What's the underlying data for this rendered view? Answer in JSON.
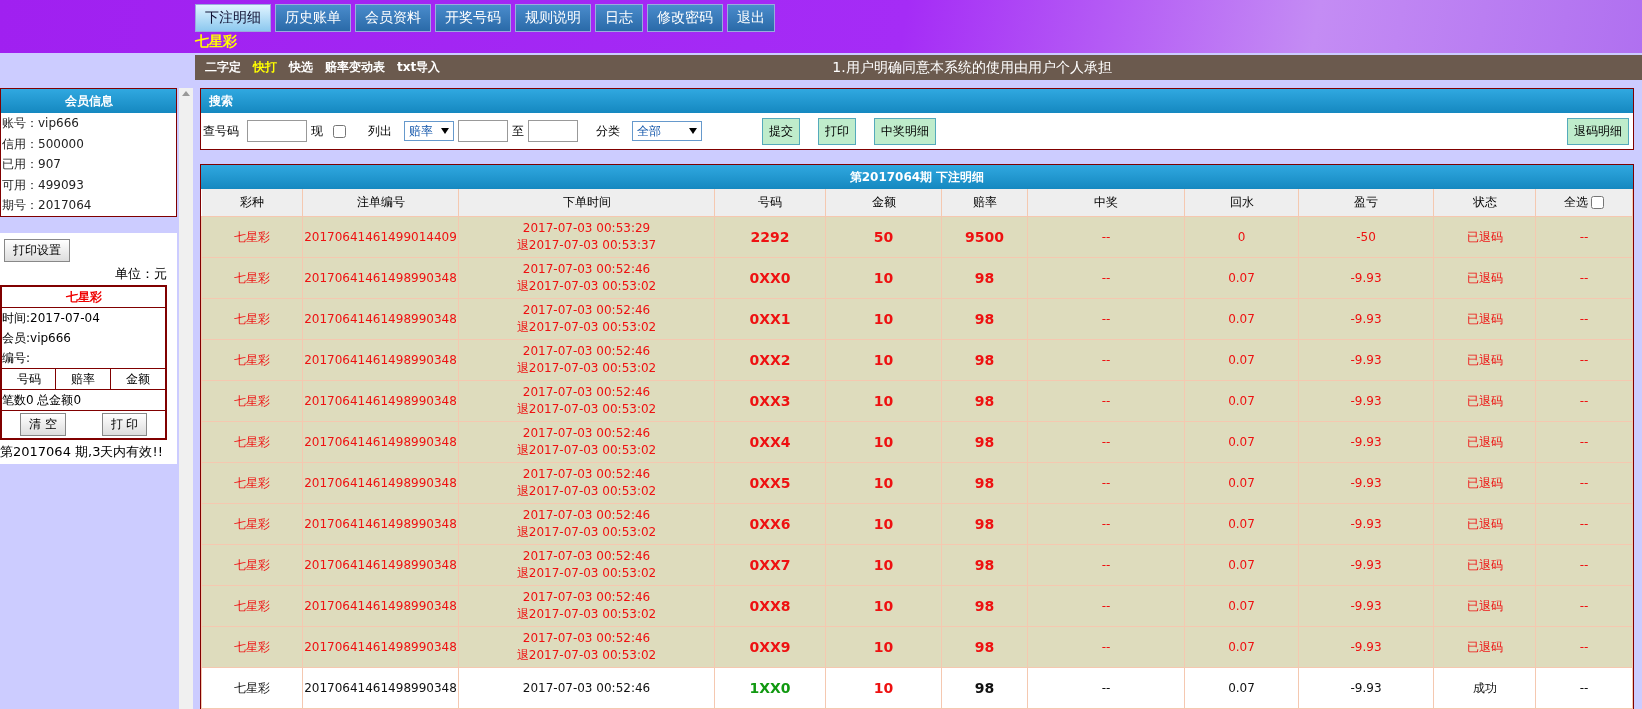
{
  "tabs": [
    {
      "label": "下注明细",
      "selected": true
    },
    {
      "label": "历史账单",
      "selected": false
    },
    {
      "label": "会员资料",
      "selected": false
    },
    {
      "label": "开奖号码",
      "selected": false
    },
    {
      "label": "规则说明",
      "selected": false
    },
    {
      "label": "日志",
      "selected": false
    },
    {
      "label": "修改密码",
      "selected": false
    },
    {
      "label": "退出",
      "selected": false
    }
  ],
  "game_title": "七星彩",
  "subnav": [
    {
      "label": "二字定",
      "selected": false
    },
    {
      "label": "快打",
      "selected": true
    },
    {
      "label": "快选",
      "selected": false
    },
    {
      "label": "赔率变动表",
      "selected": false
    },
    {
      "label": "txt导入",
      "selected": false
    }
  ],
  "notice": "1.用户明确同意本系统的使用由用户个人承担",
  "member_info": {
    "title": "会员信息",
    "fields": [
      "账号：vip666",
      "信用：500000",
      "已用：907",
      "可用：499093",
      "期号：2017064"
    ]
  },
  "print_settings_button": "打印设置",
  "unit_label": "单位：元",
  "ticket": {
    "title": "七星彩",
    "fields": [
      "时间:2017-07-04",
      "会员:vip666",
      "编号:"
    ],
    "columns": [
      "号码",
      "赔率",
      "金额"
    ],
    "summary": "笔数0 总金额0",
    "buttons": [
      "清 空",
      "打 印"
    ]
  },
  "validity_note": "第2017064 期,3天内有效!!",
  "search": {
    "title": "搜索",
    "number_label": "查号码",
    "show_label": "现",
    "show_checked": false,
    "list_label": "列出",
    "list_select": "赔率",
    "range_label": "至",
    "category_label": "分类",
    "category_select": "全部",
    "buttons": [
      "提交",
      "打印",
      "中奖明细"
    ],
    "right_button": "退码明细"
  },
  "bets": {
    "title": "第2017064期 下注明细",
    "columns": [
      "彩种",
      "注单编号",
      "下单时间",
      "号码",
      "金额",
      "赔率",
      "中奖",
      "回水",
      "盈亏",
      "状态",
      "全选"
    ],
    "select_all_checked": false,
    "rows": [
      {
        "refunded": true,
        "game": "七星彩",
        "id": "20170641461499014409",
        "time": "2017-07-03 00:53:29",
        "refund_time": "退2017-07-03 00:53:37",
        "number": "2292",
        "amount": "50",
        "odds": "9500",
        "win": "--",
        "rebate": "0",
        "profit": "-50",
        "status": "已退码",
        "select": "--"
      },
      {
        "refunded": true,
        "game": "七星彩",
        "id": "20170641461498990348",
        "time": "2017-07-03 00:52:46",
        "refund_time": "退2017-07-03 00:53:02",
        "number": "0XX0",
        "amount": "10",
        "odds": "98",
        "win": "--",
        "rebate": "0.07",
        "profit": "-9.93",
        "status": "已退码",
        "select": "--"
      },
      {
        "refunded": true,
        "game": "七星彩",
        "id": "20170641461498990348",
        "time": "2017-07-03 00:52:46",
        "refund_time": "退2017-07-03 00:53:02",
        "number": "0XX1",
        "amount": "10",
        "odds": "98",
        "win": "--",
        "rebate": "0.07",
        "profit": "-9.93",
        "status": "已退码",
        "select": "--"
      },
      {
        "refunded": true,
        "game": "七星彩",
        "id": "20170641461498990348",
        "time": "2017-07-03 00:52:46",
        "refund_time": "退2017-07-03 00:53:02",
        "number": "0XX2",
        "amount": "10",
        "odds": "98",
        "win": "--",
        "rebate": "0.07",
        "profit": "-9.93",
        "status": "已退码",
        "select": "--"
      },
      {
        "refunded": true,
        "game": "七星彩",
        "id": "20170641461498990348",
        "time": "2017-07-03 00:52:46",
        "refund_time": "退2017-07-03 00:53:02",
        "number": "0XX3",
        "amount": "10",
        "odds": "98",
        "win": "--",
        "rebate": "0.07",
        "profit": "-9.93",
        "status": "已退码",
        "select": "--"
      },
      {
        "refunded": true,
        "game": "七星彩",
        "id": "20170641461498990348",
        "time": "2017-07-03 00:52:46",
        "refund_time": "退2017-07-03 00:53:02",
        "number": "0XX4",
        "amount": "10",
        "odds": "98",
        "win": "--",
        "rebate": "0.07",
        "profit": "-9.93",
        "status": "已退码",
        "select": "--"
      },
      {
        "refunded": true,
        "game": "七星彩",
        "id": "20170641461498990348",
        "time": "2017-07-03 00:52:46",
        "refund_time": "退2017-07-03 00:53:02",
        "number": "0XX5",
        "amount": "10",
        "odds": "98",
        "win": "--",
        "rebate": "0.07",
        "profit": "-9.93",
        "status": "已退码",
        "select": "--"
      },
      {
        "refunded": true,
        "game": "七星彩",
        "id": "20170641461498990348",
        "time": "2017-07-03 00:52:46",
        "refund_time": "退2017-07-03 00:53:02",
        "number": "0XX6",
        "amount": "10",
        "odds": "98",
        "win": "--",
        "rebate": "0.07",
        "profit": "-9.93",
        "status": "已退码",
        "select": "--"
      },
      {
        "refunded": true,
        "game": "七星彩",
        "id": "20170641461498990348",
        "time": "2017-07-03 00:52:46",
        "refund_time": "退2017-07-03 00:53:02",
        "number": "0XX7",
        "amount": "10",
        "odds": "98",
        "win": "--",
        "rebate": "0.07",
        "profit": "-9.93",
        "status": "已退码",
        "select": "--"
      },
      {
        "refunded": true,
        "game": "七星彩",
        "id": "20170641461498990348",
        "time": "2017-07-03 00:52:46",
        "refund_time": "退2017-07-03 00:53:02",
        "number": "0XX8",
        "amount": "10",
        "odds": "98",
        "win": "--",
        "rebate": "0.07",
        "profit": "-9.93",
        "status": "已退码",
        "select": "--"
      },
      {
        "refunded": true,
        "game": "七星彩",
        "id": "20170641461498990348",
        "time": "2017-07-03 00:52:46",
        "refund_time": "退2017-07-03 00:53:02",
        "number": "0XX9",
        "amount": "10",
        "odds": "98",
        "win": "--",
        "rebate": "0.07",
        "profit": "-9.93",
        "status": "已退码",
        "select": "--"
      },
      {
        "refunded": false,
        "game": "七星彩",
        "id": "20170641461498990348",
        "time": "2017-07-03 00:52:46",
        "number": "1XX0",
        "amount": "10",
        "odds": "98",
        "win": "--",
        "rebate": "0.07",
        "profit": "-9.93",
        "status": "成功",
        "select": "--"
      }
    ]
  }
}
